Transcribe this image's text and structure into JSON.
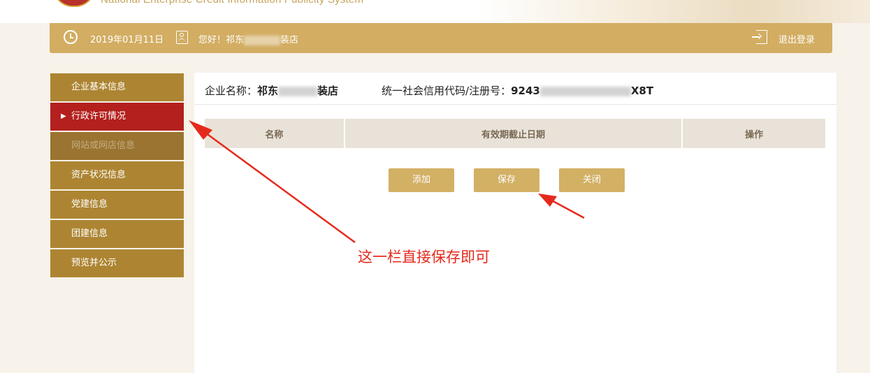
{
  "banner": {
    "subtitle": "National Enterprise Credit Information Publicity System"
  },
  "topbar": {
    "date": "2019年01月11日",
    "greeting_prefix": "您好！祁东",
    "greeting_suffix": "装店",
    "logout_label": "退出登录"
  },
  "sidebar": {
    "items": [
      {
        "label": "企业基本信息"
      },
      {
        "label": "行政许可情况"
      },
      {
        "label": "网站或网店信息"
      },
      {
        "label": "资产状况信息"
      },
      {
        "label": "党建信息"
      },
      {
        "label": "团建信息"
      },
      {
        "label": "预览并公示"
      }
    ]
  },
  "company": {
    "name_label": "企业名称：",
    "name_start": "祁东",
    "name_end": "装店",
    "code_label": "统一社会信用代码/注册号：",
    "code_start": "9243",
    "code_end": "X8T"
  },
  "table": {
    "headers": [
      "名称",
      "有效期截止日期",
      "操作"
    ]
  },
  "buttons": {
    "add": "添加",
    "save": "保存",
    "close": "关闭"
  },
  "annotation": {
    "text": "这一栏直接保存即可",
    "color": "#e52a1c"
  },
  "colors": {
    "gold_bar": "#d2ad62",
    "sidebar": "#ad8532",
    "active": "#b3201d",
    "button": "#d2b064"
  }
}
